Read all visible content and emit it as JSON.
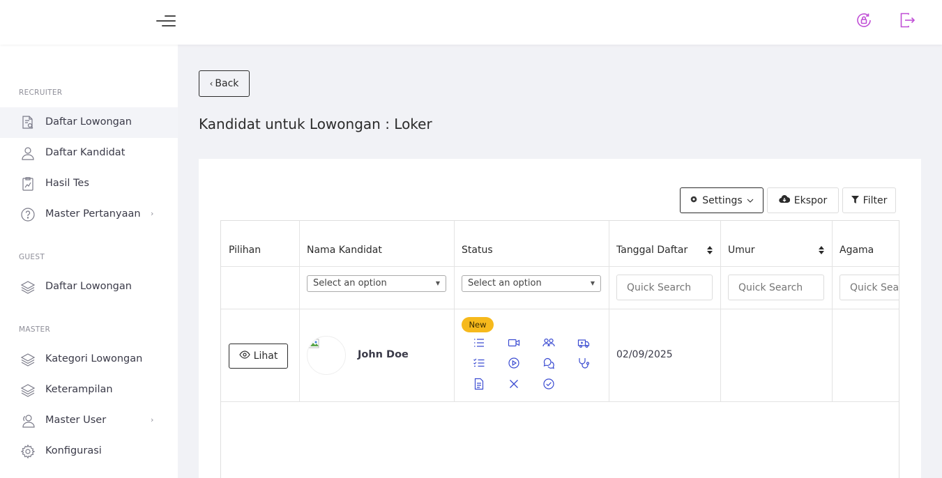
{
  "sidebar": {
    "sections": [
      {
        "title": "RECRUITER",
        "items": [
          {
            "label": "Daftar Lowongan",
            "icon": "document-search-icon",
            "active": true
          },
          {
            "label": "Daftar Kandidat",
            "icon": "user-icon"
          },
          {
            "label": "Hasil Tes",
            "icon": "chart-document-icon"
          },
          {
            "label": "Master Pertanyaan",
            "icon": "question-circle-icon",
            "has_submenu": true
          }
        ]
      },
      {
        "title": "GUEST",
        "items": [
          {
            "label": "Daftar Lowongan",
            "icon": "layers-icon"
          }
        ]
      },
      {
        "title": "MASTER",
        "items": [
          {
            "label": "Kategori Lowongan",
            "icon": "layers-icon"
          },
          {
            "label": "Keterampilan",
            "icon": "layers-icon"
          },
          {
            "label": "Master User",
            "icon": "users-icon",
            "has_submenu": true
          },
          {
            "label": "Konfigurasi",
            "icon": "gear-icon"
          }
        ]
      }
    ]
  },
  "topbar": {
    "icons": [
      "menu-icon",
      "lock-reset-icon",
      "logout-icon"
    ],
    "accent_color": "#c04fd6"
  },
  "main": {
    "back_label": "Back",
    "title": "Kandidat untuk Lowongan : Loker",
    "toolbar": {
      "settings_label": "Settings",
      "export_label": "Ekspor",
      "filter_label": "Filter"
    },
    "table": {
      "columns": [
        "Pilihan",
        "Nama Kandidat",
        "Status",
        "Tanggal Daftar",
        "Umur",
        "Agama"
      ],
      "filters": {
        "nama_placeholder": "Select an option",
        "status_placeholder": "Select an option",
        "quick_search_placeholder": "Quick Search"
      },
      "rows": [
        {
          "action_label": "Lihat",
          "name": "John Doe",
          "status_badge": "New",
          "date": "02/09/2025",
          "age": "",
          "religion": ""
        }
      ]
    }
  },
  "colors": {
    "status_icon": "#3a4bd1",
    "badge": "#f6b91c"
  }
}
